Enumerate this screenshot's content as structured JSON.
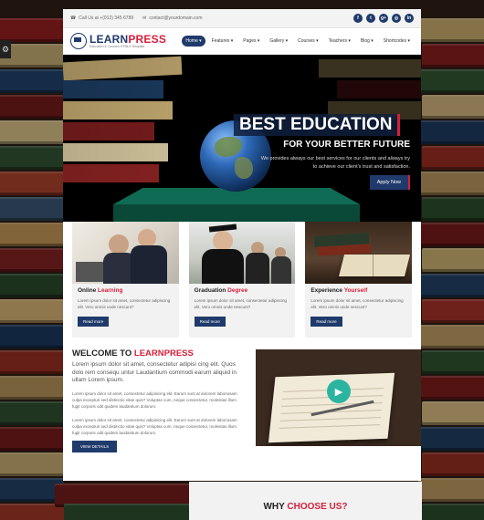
{
  "topbar": {
    "phone": "Call Us at +(012) 345 6789",
    "email": "contact@yourdomain.com",
    "socials": [
      "facebook-icon",
      "twitter-icon",
      "google-plus-icon",
      "instagram-icon",
      "linkedin-icon"
    ]
  },
  "logo": {
    "name_a": "LEARN",
    "name_b": "PRESS",
    "tagline": "Education & Courses HTML5 Template"
  },
  "nav": {
    "items": [
      {
        "label": "Home",
        "active": true
      },
      {
        "label": "Features"
      },
      {
        "label": "Pages"
      },
      {
        "label": "Gallery"
      },
      {
        "label": "Courses"
      },
      {
        "label": "Teachers"
      },
      {
        "label": "Blog"
      },
      {
        "label": "Shortcodes"
      }
    ]
  },
  "hero": {
    "title": "BEST EDUCATION",
    "subtitle": "FOR YOUR BETTER FUTURE",
    "description": "We provides always our best services for our clients and always try to achieve our client's trust and satisfaction.",
    "button": "Apply Now"
  },
  "features": [
    {
      "title_a": "Online ",
      "title_b": "Learning",
      "text": "Lorem ipsum dolor sit amet, consectetur adipiscing elit. Vero omnis unde nescunt?",
      "button": "Read more"
    },
    {
      "title_a": "Graduation ",
      "title_b": "Degree",
      "text": "Lorem ipsum dolor sit amet, consectetur adipiscing elit. Vero omnis unde nescunt?",
      "button": "Read more"
    },
    {
      "title_a": "Experience ",
      "title_b": "Yourself",
      "text": "Lorem ipsum dolor sit amet, consectetur adipiscing elit. Vero omnis unde nescunt?",
      "button": "Read more"
    }
  ],
  "welcome": {
    "title_a": "WELCOME TO ",
    "title_b": "LEARNPRESS",
    "lead": "Lorem ipsum dolor sit amet, consectetur adipisi cing elit. Quos dolo rem consequ untur Laudantium commodi earum aliquid in ullam Lorem ipsum.",
    "para1": "Lorem ipsum dolor sit amet, consectetur adipisicing elit. Earum sunt at dolorem laboriosam culpa excepturi sed distinctio vitae quis? Voluptas cum, neque consectetur, molestias illum fugit corporis odit quidem laudantium dolorum.",
    "para2": "Lorem ipsum dolor sit amet, consectetur adipisicing elit. Earum sunt at dolorem laboriosam culpa excepturi sed distinctio vitae quis? Voluptas cum, neque consectetur, molestias illum fugit corporis odit quidem laudantium dolorum.",
    "button": "VIEW DETAILS"
  },
  "why": {
    "title_a": "WHY ",
    "title_b": "CHOOSE US?"
  },
  "colors": {
    "navy": "#1f3a6b",
    "accent": "#d71f3a",
    "teal": "#2bb5a0"
  }
}
